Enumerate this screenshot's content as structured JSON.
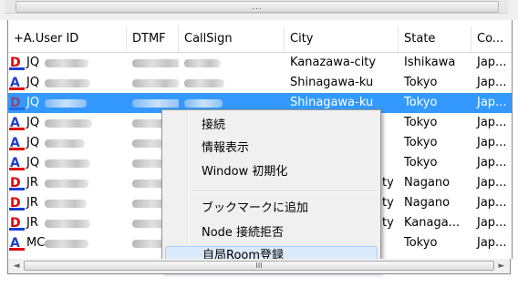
{
  "scroll_top_grip": "...",
  "scroll_bottom_grip": "III",
  "scroll_left_arrow": "◄",
  "scroll_right_arrow": "►",
  "columns": [
    "+A.User ID",
    "DTMF",
    "CallSign",
    "City",
    "State",
    "Co..."
  ],
  "rows": [
    {
      "badge": "D",
      "user_id": "JQ",
      "city": "Kanazawa-city",
      "state": "Ishikawa",
      "country": "Jap..."
    },
    {
      "badge": "A",
      "user_id": "JQ",
      "city": "Shinagawa-ku",
      "state": "Tokyo",
      "country": "Jap..."
    },
    {
      "badge": "D",
      "user_id": "JQ",
      "city": "Shinagawa-ku",
      "state": "Tokyo",
      "country": "Jap..."
    },
    {
      "badge": "A",
      "user_id": "JQ",
      "city": "",
      "state": "Tokyo",
      "country": "Jap..."
    },
    {
      "badge": "A",
      "user_id": "JQ",
      "city": "",
      "state": "Tokyo",
      "country": "Jap..."
    },
    {
      "badge": "A",
      "user_id": "JQ",
      "city": "",
      "state": "Tokyo",
      "country": "Jap..."
    },
    {
      "badge": "D",
      "user_id": "JR",
      "city": "ty",
      "state": "Nagano",
      "country": "Jap..."
    },
    {
      "badge": "D",
      "user_id": "JR",
      "city": "ty",
      "state": "Nagano",
      "country": "Jap..."
    },
    {
      "badge": "D",
      "user_id": "JR",
      "city": "ty",
      "state": "Kanaga...",
      "country": "Jap..."
    },
    {
      "badge": "A",
      "user_id": "MC",
      "city": "",
      "state": "Tokyo",
      "country": "Jap..."
    }
  ],
  "selected_row": 2,
  "context_menu": {
    "items": [
      "接続",
      "情報表示",
      "Window 初期化",
      "ブックマークに追加",
      "Node 接続拒否",
      "自局Room登録"
    ],
    "highlighted": "自局Room登録"
  },
  "colors": {
    "selection": "#3399ff",
    "badge_d": "#e00000",
    "badge_a": "#1a3fd0"
  }
}
